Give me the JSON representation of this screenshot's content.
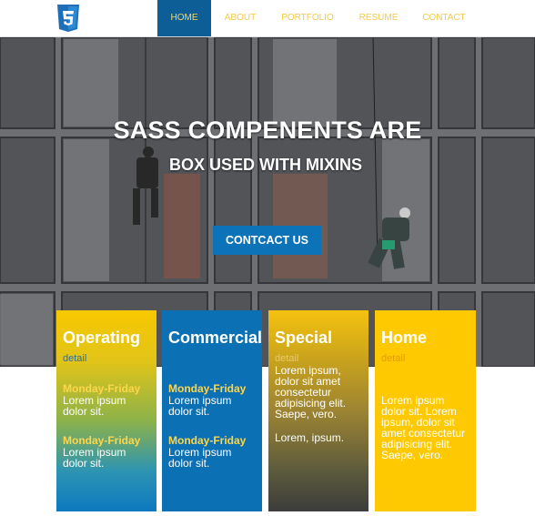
{
  "header": {
    "logo_icon": "css3-shield-icon",
    "nav": [
      "HOME",
      "ABOUT",
      "PORTFOLIO",
      "RESUME",
      "CONTACT"
    ],
    "active": "HOME"
  },
  "hero": {
    "title_line1": "SASS COMPENENTS ARE",
    "title_line2": "BOX USED WITH MIXINS",
    "cta_label": "CONTCACT US"
  },
  "cards": [
    {
      "title": "Operating",
      "detail": "detail",
      "blocks": [
        {
          "day": "Monday-Friday",
          "text": "Lorem ipsum dolor sit."
        },
        {
          "day": "Monday-Friday",
          "text": "Lorem ipsum dolor sit."
        }
      ]
    },
    {
      "title": "Commercial",
      "detail": "",
      "blocks": [
        {
          "day": "Monday-Friday",
          "text": "Lorem ipsum dolor sit."
        },
        {
          "day": "Monday-Friday",
          "text": "Lorem ipsum dolor sit."
        }
      ]
    },
    {
      "title": "Special",
      "detail": "detail",
      "text1": "Lorem ipsum, dolor sit amet consectetur adipisicing elit. Saepe, vero.",
      "text2": "Lorem, ipsum."
    },
    {
      "title": "Home",
      "detail": "detail",
      "text1": "Lorem ipsum dolor sit. Lorem ipsum, dolor sit amet consectetur adipisicing elit. Saepe, vero."
    }
  ],
  "colors": {
    "nav_active_bg": "#0d5d97",
    "nav_text": "#f2c94c",
    "cta_bg": "#0d73b8",
    "card_blue": "#0c70b4",
    "card_yellow": "#fec901",
    "day_text": "#ffd64a"
  }
}
